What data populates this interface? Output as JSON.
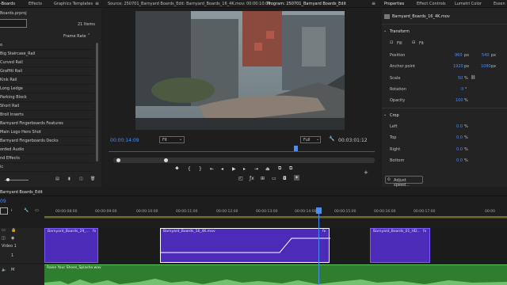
{
  "project_panel": {
    "tabs": [
      "-Boards",
      "Effects",
      "Graphics Templates"
    ],
    "project_file": "Boards.prproj",
    "item_count": "21 Items",
    "column_header": "Frame Rate",
    "items": [
      "o",
      "Big Staircase_Rail",
      "Curved Rail",
      "Graffiti Rail",
      "Kink Rail",
      "Long Ledge",
      "Parking Block",
      "Short Rail",
      "Broll Inserts",
      "Barnyard Fingerboards Features",
      "Main Logo Hero Shot",
      "Barnyard Fingerboards Decks",
      "orded Audio",
      "nd Effects",
      "ic"
    ]
  },
  "source_monitor": {
    "source_tab": "Source: 250701_Barnyard Boards_Edit: Barnyard_Boards_16_4K.mov: 00:00:10:09",
    "program_tab": "Program: 250701_Barnyard Boards_Edit",
    "timecode_left": "00:00:14:09",
    "fit_label": "Fit",
    "full_label": "Full",
    "timecode_right": "00:03:01:12"
  },
  "properties_panel": {
    "tabs": [
      "Properties",
      "Effect Controls",
      "Lumetri Color",
      "Essen"
    ],
    "clip_name": "Barnyard_Boards_16_4K.mov",
    "transform": {
      "title": "Transform",
      "fill_label": "Fill",
      "fit_label": "Fit",
      "position_label": "Position",
      "position_x": "960",
      "position_y": "540",
      "anchor_label": "Anchor point",
      "anchor_x": "1920",
      "anchor_y": "1080",
      "scale_label": "Scale",
      "scale_value": "50",
      "scale_unit": "%",
      "rotation_label": "Rotation",
      "rotation_value": "0",
      "rotation_unit": "°",
      "opacity_label": "Opacity",
      "opacity_value": "100",
      "opacity_unit": "%",
      "px": "px"
    },
    "crop": {
      "title": "Crop",
      "rows": [
        {
          "label": "Left",
          "value": "0.0",
          "unit": "%"
        },
        {
          "label": "Top",
          "value": "0.0",
          "unit": "%"
        },
        {
          "label": "Right",
          "value": "0.0",
          "unit": "%"
        },
        {
          "label": "Bottom",
          "value": "0.0",
          "unit": "%"
        }
      ]
    },
    "adjust_speed": "Adjust speed..."
  },
  "timeline": {
    "sequence_tab": "Barnyard Boards_Edit",
    "timecode_fragment": "09",
    "ruler_labels": [
      "00:00:08:00",
      "00:00:09:00",
      "00:00:10:00",
      "00:00:11:00",
      "00:00:12:00",
      "00:00:13:00",
      "00:00:14:00",
      "00:00:15:00",
      "00:00:16:00",
      "00:00:17:00",
      "00:00"
    ],
    "track_v1_label": "Video 1",
    "track_v1_index": "1",
    "clips": [
      {
        "name": "Barnyard_Boards_29_...",
        "fx": "fx"
      },
      {
        "name": "Barnyard_Boards_16_4K.mov",
        "fx": "fx"
      },
      {
        "name": "Barnyard_Boards_01_HD...",
        "fx": "fx"
      }
    ],
    "audio_clip_name": "Raise Your Shoes_Splashe.wav",
    "colors": {
      "video_clip": "#4b2bb8",
      "audio_clip": "#2f7d2f",
      "accent": "#4a8cff"
    }
  }
}
